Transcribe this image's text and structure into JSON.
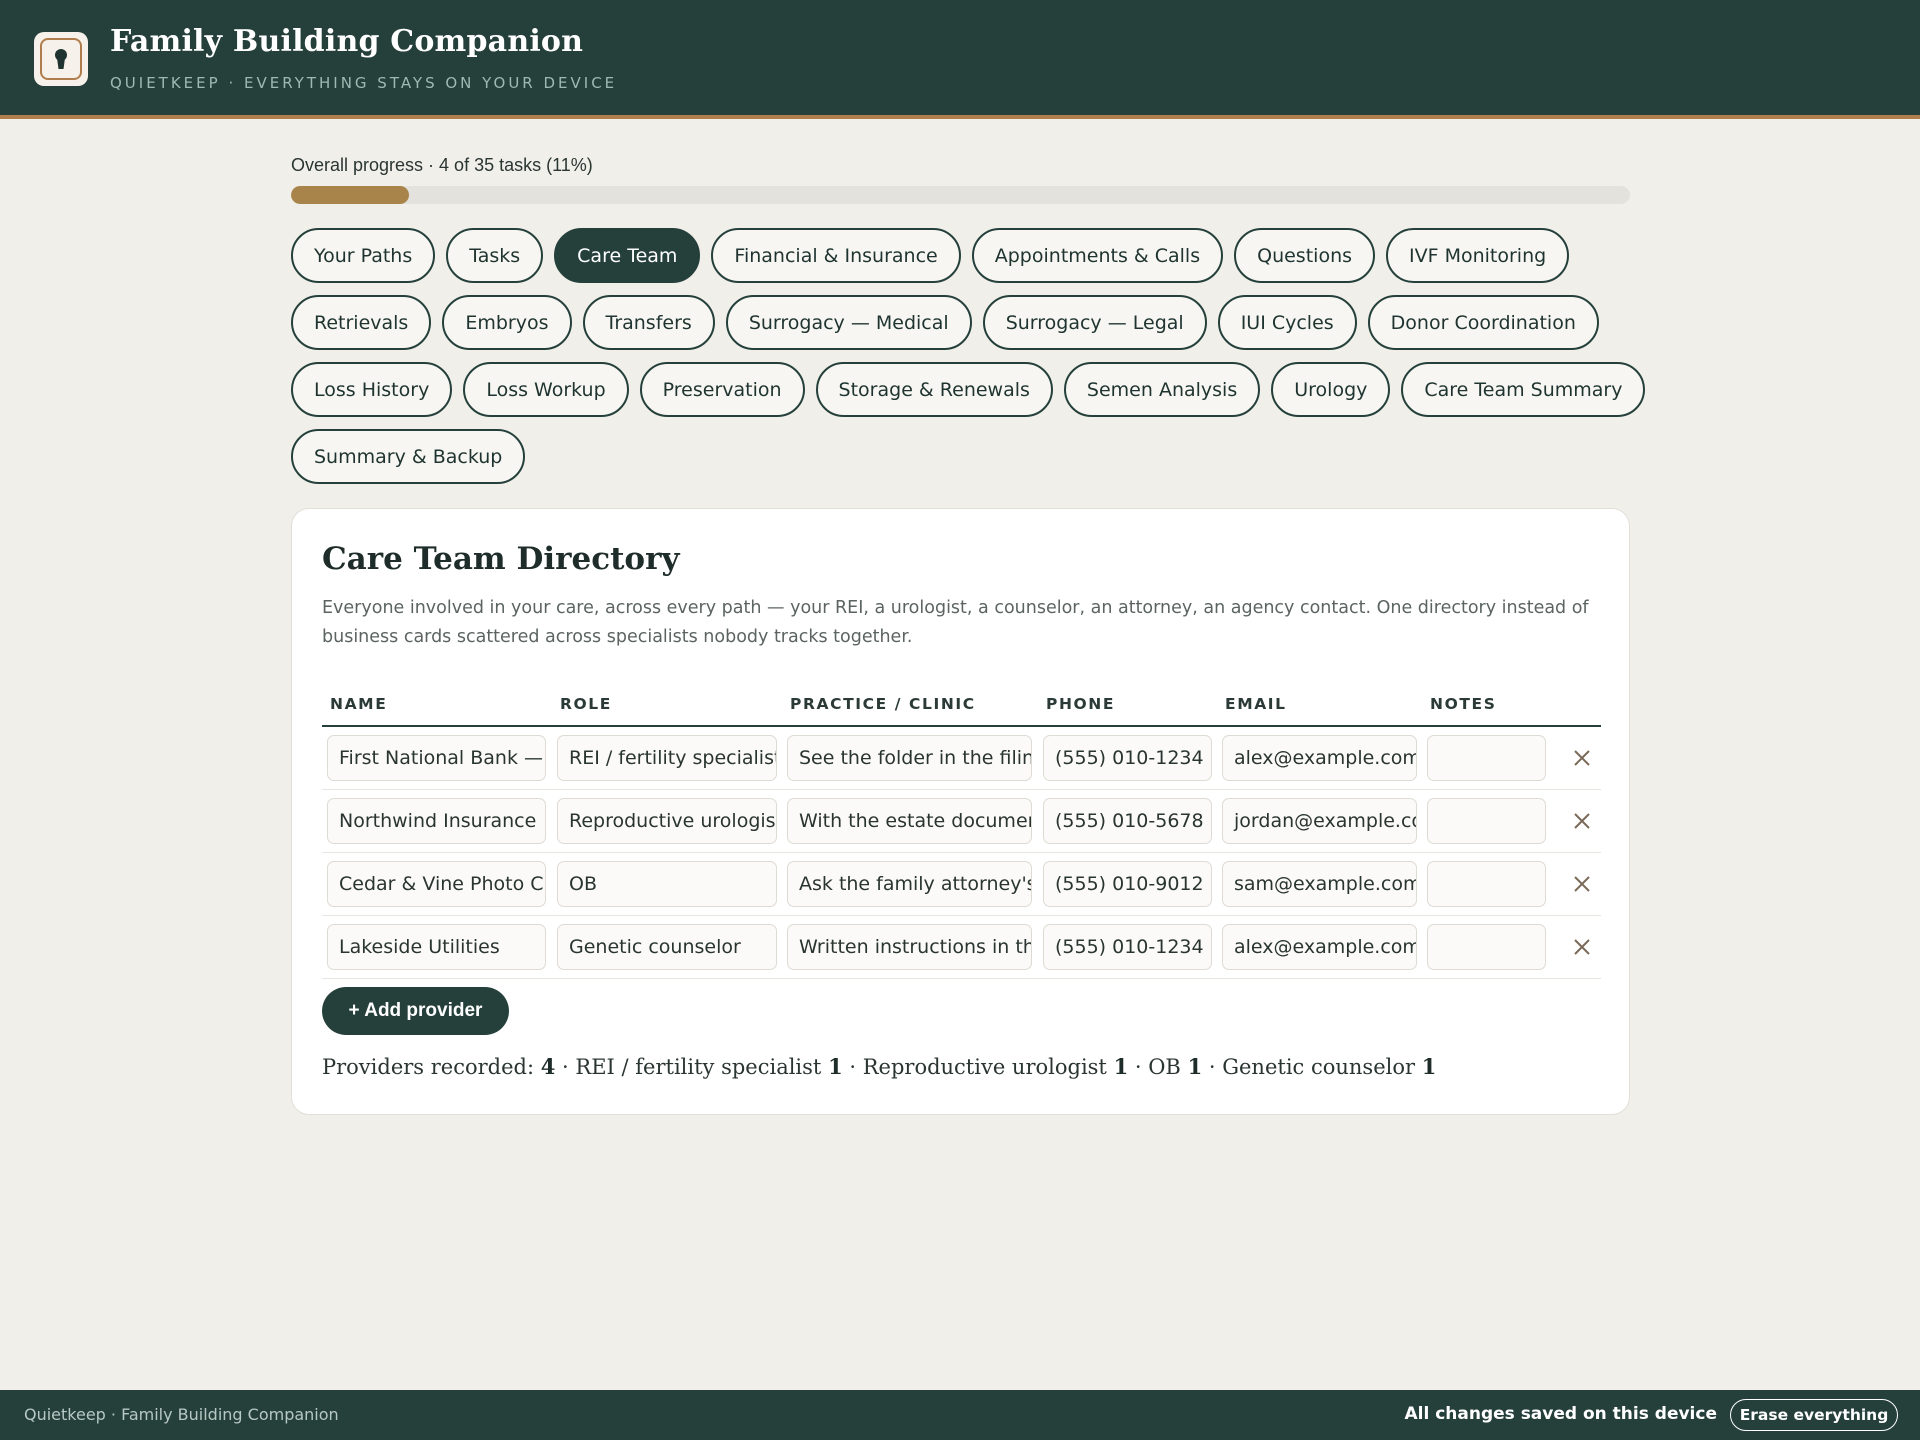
{
  "header": {
    "title": "Family Building Companion",
    "subtitle": "QUIETKEEP · EVERYTHING STAYS ON YOUR DEVICE"
  },
  "progress": {
    "label": "Overall progress · 4 of 35 tasks (11%)",
    "done": 4,
    "total": 35,
    "fraction": 0.11
  },
  "tabs": [
    {
      "label": "Your Paths"
    },
    {
      "label": "Tasks"
    },
    {
      "label": "Care Team",
      "active": true
    },
    {
      "label": "Financial & Insurance"
    },
    {
      "label": "Appointments & Calls"
    },
    {
      "label": "Questions"
    },
    {
      "label": "IVF Monitoring"
    },
    {
      "label": "Retrievals"
    },
    {
      "label": "Embryos"
    },
    {
      "label": "Transfers"
    },
    {
      "label": "Surrogacy — Medical"
    },
    {
      "label": "Surrogacy — Legal"
    },
    {
      "label": "IUI Cycles"
    },
    {
      "label": "Donor Coordination"
    },
    {
      "label": "Loss History"
    },
    {
      "label": "Loss Workup"
    },
    {
      "label": "Preservation"
    },
    {
      "label": "Storage & Renewals"
    },
    {
      "label": "Semen Analysis"
    },
    {
      "label": "Urology"
    },
    {
      "label": "Care Team Summary"
    },
    {
      "label": "Summary & Backup"
    }
  ],
  "card": {
    "title": "Care Team Directory",
    "description": "Everyone involved in your care, across every path — your REI, a urologist, a counselor, an attorney, an agency contact. One directory instead of business cards scattered across specialists nobody tracks together.",
    "columns": [
      "NAME",
      "ROLE",
      "PRACTICE / CLINIC",
      "PHONE",
      "EMAIL",
      "NOTES"
    ],
    "rows": [
      {
        "name": "First National Bank — claims",
        "role": "REI / fertility specialist",
        "practice": "See the folder in the filing cabinet",
        "phone": "(555) 010-1234",
        "email": "alex@example.com",
        "notes": ""
      },
      {
        "name": "Northwind Insurance",
        "role": "Reproductive urologist",
        "practice": "With the estate documents",
        "phone": "(555) 010-5678",
        "email": "jordan@example.com",
        "notes": ""
      },
      {
        "name": "Cedar & Vine Photo Club",
        "role": "OB",
        "practice": "Ask the family attorney's office",
        "phone": "(555) 010-9012",
        "email": "sam@example.com",
        "notes": ""
      },
      {
        "name": "Lakeside Utilities",
        "role": "Genetic counselor",
        "practice": "Written instructions in the safe",
        "phone": "(555) 010-1234",
        "email": "alex@example.com",
        "notes": ""
      }
    ],
    "add_button": "+ Add provider",
    "summary": {
      "label": "Providers recorded:",
      "total": "4",
      "items": [
        {
          "role": "REI / fertility specialist",
          "count": "1"
        },
        {
          "role": "Reproductive urologist",
          "count": "1"
        },
        {
          "role": "OB",
          "count": "1"
        },
        {
          "role": "Genetic counselor",
          "count": "1"
        }
      ]
    }
  },
  "footer": {
    "left": "Quietkeep · Family Building Companion",
    "status": "All changes saved on this device",
    "erase_button": "Erase everything"
  },
  "colors": {
    "brand": "#25403b",
    "accent": "#b07e4d",
    "progress": "#a8844a",
    "background": "#f1efea"
  }
}
